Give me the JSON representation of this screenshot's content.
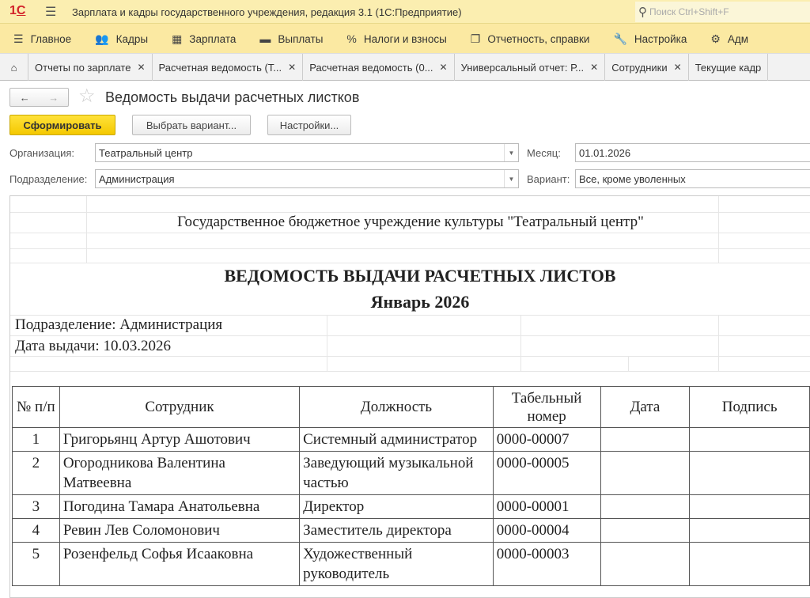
{
  "app": {
    "title": "Зарплата и кадры государственного учреждения, редакция 3.1  (1С:Предприятие)",
    "search_placeholder": "Поиск Ctrl+Shift+F",
    "logo": "1С"
  },
  "sections": [
    {
      "icon": "menu-icon",
      "glyph": "☰",
      "label": "Главное"
    },
    {
      "icon": "users-icon",
      "glyph": "👥",
      "label": "Кадры"
    },
    {
      "icon": "calculator-icon",
      "glyph": "▦",
      "label": "Зарплата"
    },
    {
      "icon": "wallet-icon",
      "glyph": "▬",
      "label": "Выплаты"
    },
    {
      "icon": "percent-icon",
      "glyph": "%",
      "label": "Налоги и взносы"
    },
    {
      "icon": "documents-icon",
      "glyph": "❐",
      "label": "Отчетность, справки"
    },
    {
      "icon": "wrench-icon",
      "glyph": "🔧",
      "label": "Настройка"
    },
    {
      "icon": "gear-icon",
      "glyph": "⚙",
      "label": "Адм"
    }
  ],
  "tabs": [
    {
      "label": "Отчеты по зарплате"
    },
    {
      "label": "Расчетная ведомость (Т..."
    },
    {
      "label": "Расчетная ведомость (0..."
    },
    {
      "label": "Универсальный отчет: Р..."
    },
    {
      "label": "Сотрудники"
    },
    {
      "label": "Текущие кадр"
    }
  ],
  "form": {
    "title": "Ведомость выдачи расчетных листков",
    "generate": "Сформировать",
    "choose_variant": "Выбрать вариант...",
    "settings": "Настройки...",
    "org_label": "Организация:",
    "org_value": "Театральный центр",
    "month_label": "Месяц:",
    "month_value": "01.01.2026",
    "dept_label": "Подразделение:",
    "dept_value": "Администрация",
    "variant_label": "Вариант:",
    "variant_value": "Все, кроме уволенных"
  },
  "report": {
    "org": "Государственное бюджетное учреждение культуры \"Театральный центр\"",
    "title": "ВЕДОМОСТЬ ВЫДАЧИ РАСЧЕТНЫХ ЛИСТОВ",
    "period": "Январь 2026",
    "dept": "Подразделение: Администрация",
    "date": "Дата выдачи: 10.03.2026",
    "headers": [
      "№ п/п",
      "Сотрудник",
      "Должность",
      "Табельный номер",
      "Дата",
      "Подпись"
    ],
    "rows": [
      {
        "n": "1",
        "name": "Григорьянц Артур Ашотович",
        "position": "Системный администратор",
        "tab": "0000-00007"
      },
      {
        "n": "2",
        "name": "Огородникова Валентина Матвеевна",
        "position": "Заведующий музыкальной частью",
        "tab": "0000-00005"
      },
      {
        "n": "3",
        "name": "Погодина Тамара Анатольевна",
        "position": "Директор",
        "tab": "0000-00001"
      },
      {
        "n": "4",
        "name": "Ревин Лев Соломонович",
        "position": "Заместитель директора",
        "tab": "0000-00004"
      },
      {
        "n": "5",
        "name": "Розенфельд Софья Исааковна",
        "position": "Художественный руководитель",
        "tab": "0000-00003"
      }
    ]
  }
}
